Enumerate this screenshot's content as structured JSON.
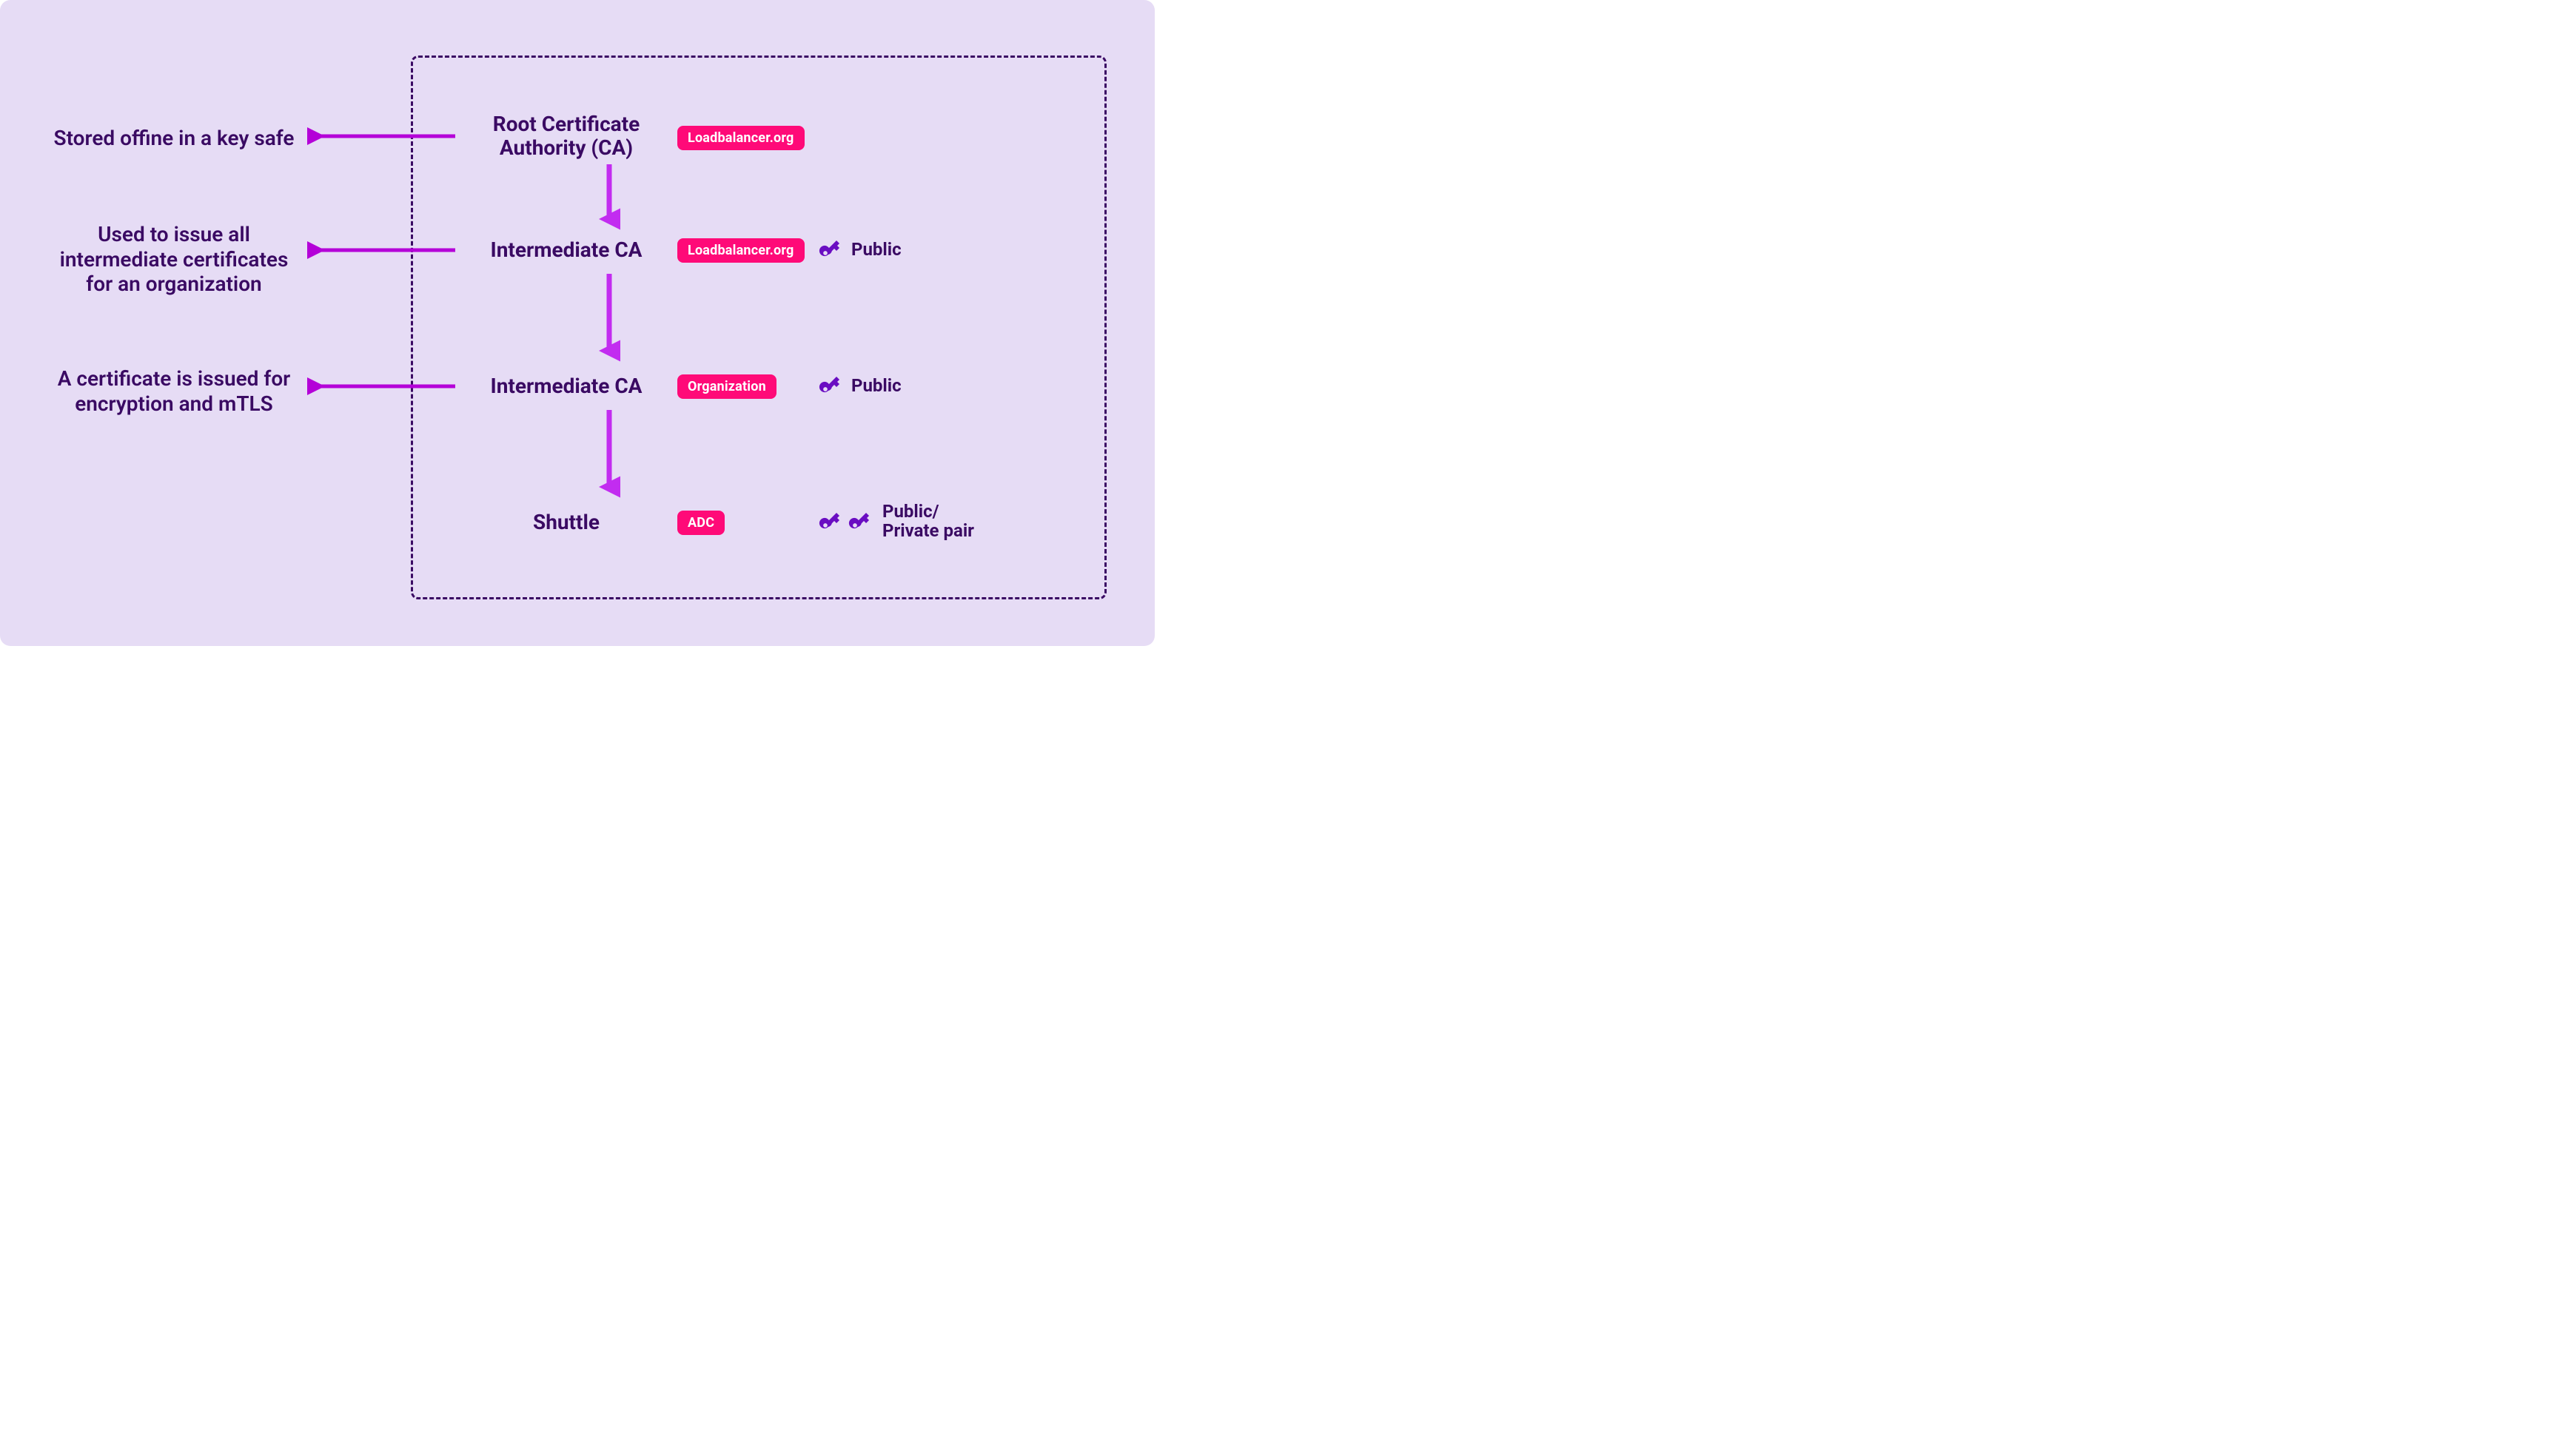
{
  "descriptions": {
    "root": "Stored offine in a key safe",
    "intermediate1": "Used to issue all intermediate certificates for an organization",
    "intermediate2": "A certificate is issued for encryption and mTLS"
  },
  "nodes": {
    "root": {
      "label_line1": "Root Certificate",
      "label_line2": "Authority (CA)",
      "badge": "Loadbalancer.org"
    },
    "intermediate1": {
      "label": "Intermediate CA",
      "badge": "Loadbalancer.org",
      "key_label": "Public"
    },
    "intermediate2": {
      "label": "Intermediate CA",
      "badge": "Organization",
      "key_label": "Public"
    },
    "shuttle": {
      "label": "Shuttle",
      "badge": "ADC",
      "key_label_line1": "Public/",
      "key_label_line2": "Private pair"
    }
  },
  "colors": {
    "bg": "#e6dcf5",
    "dash": "#3a0a63",
    "text": "#3a0a63",
    "badge": "#ff0a78",
    "arrow_h": "#b400d8",
    "arrow_v": "#c22cf0",
    "key": "#6a0dc2"
  }
}
